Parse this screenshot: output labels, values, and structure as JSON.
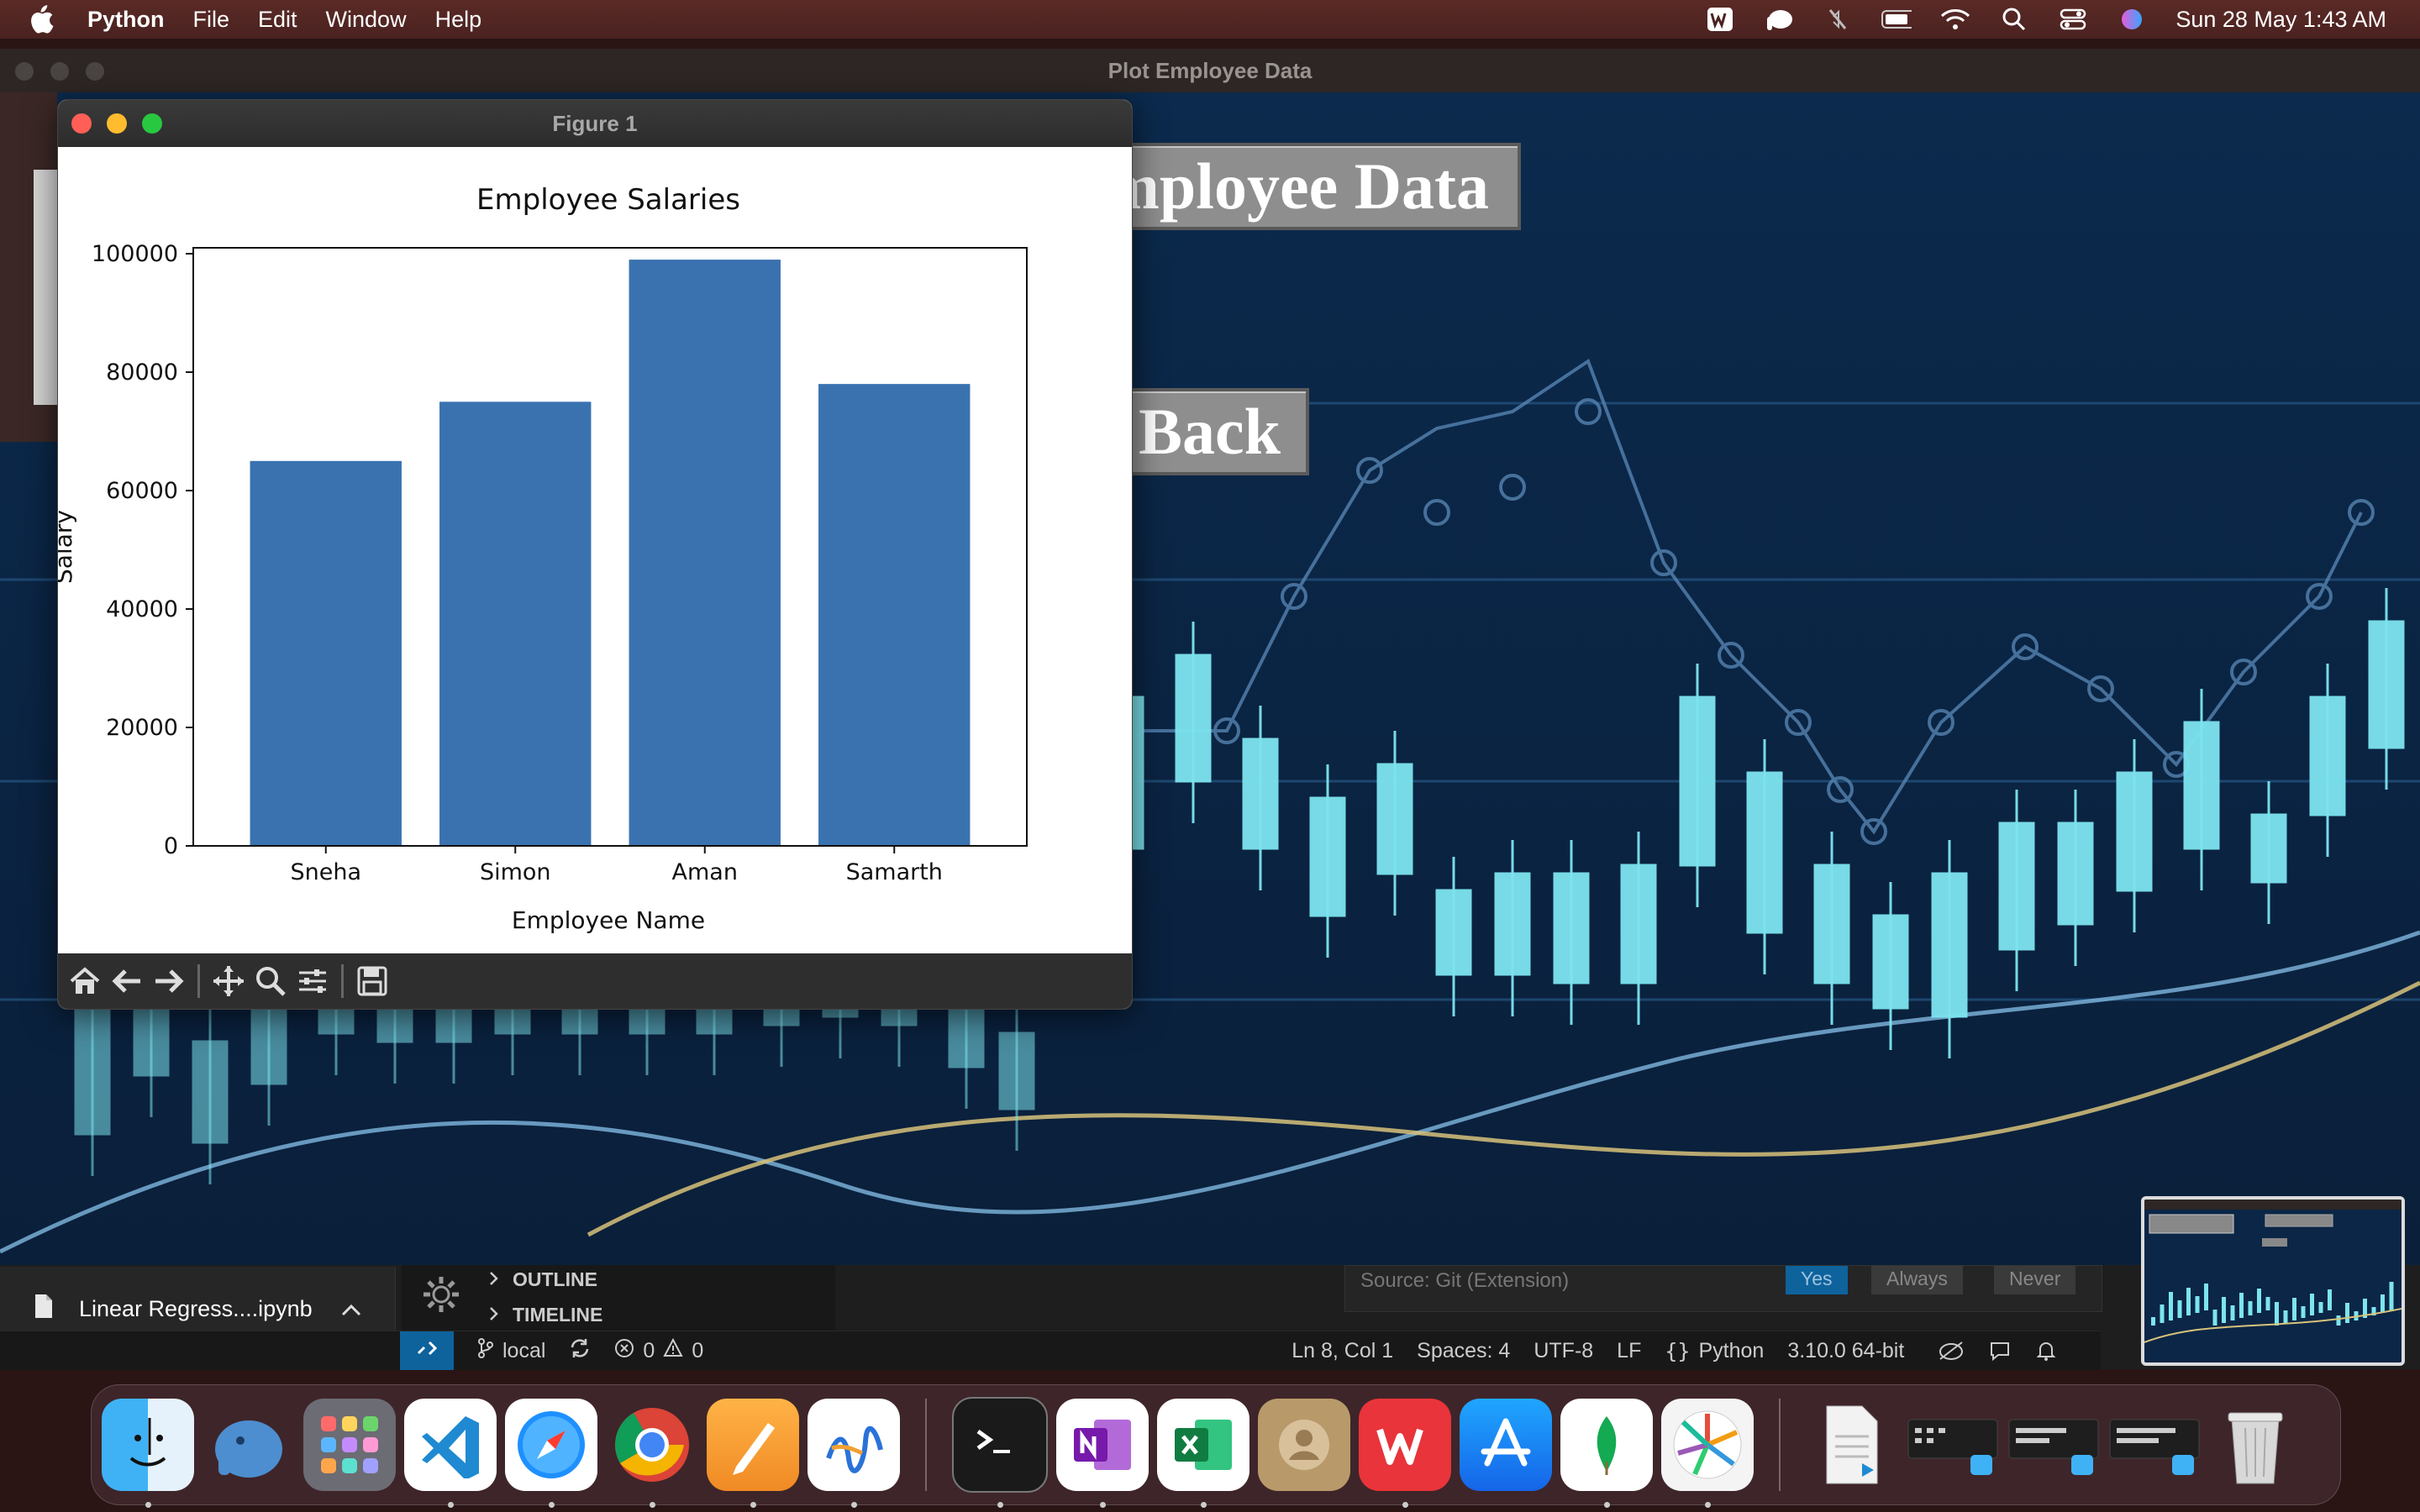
{
  "menubar": {
    "app_name": "Python",
    "items": [
      "File",
      "Edit",
      "Window",
      "Help"
    ],
    "clock": "Sun 28 May  1:43 AM"
  },
  "tk_window": {
    "title": "Plot Employee Data",
    "plot_button_label": "Plot Employee Data",
    "back_button_label": "Back"
  },
  "figure_window": {
    "title": "Figure 1",
    "toolbar": [
      "home-icon",
      "back-arrow-icon",
      "forward-arrow-icon",
      "pan-icon",
      "zoom-icon",
      "configure-subplots-icon",
      "save-icon"
    ]
  },
  "chart_data": {
    "type": "bar",
    "title": "Employee Salaries",
    "xlabel": "Employee Name",
    "ylabel": "Salary",
    "categories": [
      "Sneha",
      "Simon",
      "Aman",
      "Samarth"
    ],
    "values": [
      65000,
      75000,
      99000,
      78000
    ],
    "ylim": [
      0,
      101000
    ],
    "yticks": [
      0,
      20000,
      40000,
      60000,
      80000,
      100000
    ],
    "ytick_labels": [
      "0",
      "20000",
      "40000",
      "60000",
      "80000",
      "100000"
    ],
    "bar_color": "#3a72b0",
    "grid": false
  },
  "vscode": {
    "open_file": "Linear Regress....ipynb",
    "panel_sections": [
      "OUTLINE",
      "TIMELINE"
    ],
    "notification_source": "Source: Git (Extension)",
    "notification_buttons": [
      "Yes",
      "Always",
      "Never"
    ],
    "status": {
      "branch": "local",
      "errors": "0",
      "warnings": "0",
      "position": "Ln 8, Col 1",
      "spaces": "Spaces: 4",
      "encoding": "UTF-8",
      "eol": "LF",
      "language": "Python",
      "interpreter": "3.10.0 64-bit"
    },
    "accent_color": "#0e639c"
  },
  "dock": {
    "apps": [
      "finder-icon",
      "tableplus-icon",
      "launchpad-icon",
      "vscode-icon",
      "safari-icon",
      "chrome-icon",
      "pages-icon",
      "freeform-icon",
      "terminal-icon",
      "onenote-icon",
      "excel-icon",
      "contacts-icon",
      "wps-icon",
      "app-store-icon",
      "mongodb-compass-icon",
      "pinwheel-icon",
      "document-icon",
      "window-thumb-1-icon",
      "window-thumb-2-icon",
      "window-thumb-3-icon",
      "trash-icon"
    ]
  }
}
